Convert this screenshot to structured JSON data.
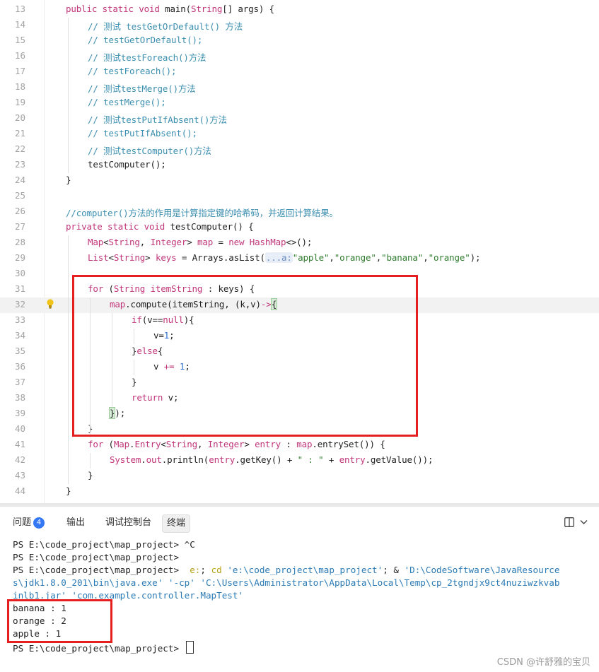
{
  "editor": {
    "current_line": 32,
    "lines": [
      {
        "n": "13",
        "tokens": [
          [
            "kw",
            "public static void "
          ],
          [
            "fn",
            "main("
          ],
          [
            "ty",
            "String"
          ],
          [
            "fn",
            "[] args) {"
          ]
        ],
        "indent": 0
      },
      {
        "n": "14",
        "tokens": [
          [
            "cm",
            "// 测试 testGetOrDefault() 方法"
          ]
        ],
        "indent": 1
      },
      {
        "n": "15",
        "tokens": [
          [
            "cm",
            "// testGetOrDefault();"
          ]
        ],
        "indent": 1
      },
      {
        "n": "16",
        "tokens": [
          [
            "cm",
            "// 测试testForeach()方法"
          ]
        ],
        "indent": 1
      },
      {
        "n": "17",
        "tokens": [
          [
            "cm",
            "// testForeach();"
          ]
        ],
        "indent": 1
      },
      {
        "n": "18",
        "tokens": [
          [
            "cm",
            "// 测试testMerge()方法"
          ]
        ],
        "indent": 1
      },
      {
        "n": "19",
        "tokens": [
          [
            "cm",
            "// testMerge();"
          ]
        ],
        "indent": 1
      },
      {
        "n": "20",
        "tokens": [
          [
            "cm",
            "// 测试testPutIfAbsent()方法"
          ]
        ],
        "indent": 1
      },
      {
        "n": "21",
        "tokens": [
          [
            "cm",
            "// testPutIfAbsent();"
          ]
        ],
        "indent": 1
      },
      {
        "n": "22",
        "tokens": [
          [
            "cm",
            "// 测试testComputer()方法"
          ]
        ],
        "indent": 1
      },
      {
        "n": "23",
        "tokens": [
          [
            "fn",
            "testComputer();"
          ]
        ],
        "indent": 1
      },
      {
        "n": "24",
        "tokens": [
          [
            "fn",
            "}"
          ]
        ],
        "indent": 0
      },
      {
        "n": "25",
        "tokens": [],
        "indent": 0
      },
      {
        "n": "26",
        "tokens": [
          [
            "cm",
            "//computer()方法的作用是计算指定键的哈希码，并返回计算结果。"
          ]
        ],
        "indent": 0
      },
      {
        "n": "27",
        "tokens": [
          [
            "kw",
            "private static void "
          ],
          [
            "fn",
            "testComputer() {"
          ]
        ],
        "indent": 0
      },
      {
        "n": "28",
        "tokens": [
          [
            "ty",
            "Map"
          ],
          [
            "fn",
            "<"
          ],
          [
            "ty",
            "String"
          ],
          [
            "fn",
            ", "
          ],
          [
            "ty",
            "Integer"
          ],
          [
            "fn",
            "> "
          ],
          [
            "fld",
            "map"
          ],
          [
            "fn",
            " = "
          ],
          [
            "kw",
            "new "
          ],
          [
            "ty",
            "HashMap"
          ],
          [
            "fn",
            "<>();"
          ]
        ],
        "indent": 1
      },
      {
        "n": "29",
        "tokens": [
          [
            "ty",
            "List"
          ],
          [
            "fn",
            "<"
          ],
          [
            "ty",
            "String"
          ],
          [
            "fn",
            "> "
          ],
          [
            "fld",
            "keys"
          ],
          [
            "fn",
            " = Arrays.asList("
          ],
          [
            "hint",
            "...a:"
          ],
          [
            "st",
            "\"apple\""
          ],
          [
            "fn",
            ","
          ],
          [
            "st",
            "\"orange\""
          ],
          [
            "fn",
            ","
          ],
          [
            "st",
            "\"banana\""
          ],
          [
            "fn",
            ","
          ],
          [
            "st",
            "\"orange\""
          ],
          [
            "fn",
            ");"
          ]
        ],
        "indent": 1
      },
      {
        "n": "30",
        "tokens": [],
        "indent": 0
      },
      {
        "n": "31",
        "tokens": [
          [
            "kw",
            "for "
          ],
          [
            "fn",
            "("
          ],
          [
            "ty",
            "String "
          ],
          [
            "fld",
            "itemString"
          ],
          [
            "fn",
            " : keys) {"
          ]
        ],
        "indent": 1
      },
      {
        "n": "32",
        "tokens": [
          [
            "fld",
            "map"
          ],
          [
            "fn",
            ".compute(itemString, (k,v)"
          ],
          [
            "kw",
            "->"
          ],
          [
            "bracematch",
            "{"
          ]
        ],
        "indent": 2
      },
      {
        "n": "33",
        "tokens": [
          [
            "kw",
            "if"
          ],
          [
            "fn",
            "(v=="
          ],
          [
            "kw",
            "null"
          ],
          [
            "fn",
            "){"
          ]
        ],
        "indent": 3
      },
      {
        "n": "34",
        "tokens": [
          [
            "fn",
            "v="
          ],
          [
            "nm",
            "1"
          ],
          [
            "fn",
            ";"
          ]
        ],
        "indent": 4
      },
      {
        "n": "35",
        "tokens": [
          [
            "fn",
            "}"
          ],
          [
            "kw",
            "else"
          ],
          [
            "fn",
            "{"
          ]
        ],
        "indent": 3
      },
      {
        "n": "36",
        "tokens": [
          [
            "fn",
            "v "
          ],
          [
            "kw",
            "+="
          ],
          [
            "fn",
            " "
          ],
          [
            "nm",
            "1"
          ],
          [
            "fn",
            ";"
          ]
        ],
        "indent": 4
      },
      {
        "n": "37",
        "tokens": [
          [
            "fn",
            "}"
          ]
        ],
        "indent": 3
      },
      {
        "n": "38",
        "tokens": [
          [
            "kw",
            "return "
          ],
          [
            "fn",
            "v;"
          ]
        ],
        "indent": 3
      },
      {
        "n": "39",
        "tokens": [
          [
            "bracematch",
            "}"
          ],
          [
            "fn",
            ");"
          ]
        ],
        "indent": 2
      },
      {
        "n": "40",
        "tokens": [
          [
            "fn",
            "}"
          ]
        ],
        "indent": 1
      },
      {
        "n": "41",
        "tokens": [
          [
            "kw",
            "for "
          ],
          [
            "fn",
            "("
          ],
          [
            "ty",
            "Map"
          ],
          [
            "fn",
            "."
          ],
          [
            "ty",
            "Entry"
          ],
          [
            "fn",
            "<"
          ],
          [
            "ty",
            "String"
          ],
          [
            "fn",
            ", "
          ],
          [
            "ty",
            "Integer"
          ],
          [
            "fn",
            "> "
          ],
          [
            "fld",
            "entry"
          ],
          [
            "fn",
            " : "
          ],
          [
            "fld",
            "map"
          ],
          [
            "fn",
            ".entrySet()) {"
          ]
        ],
        "indent": 1
      },
      {
        "n": "42",
        "tokens": [
          [
            "ty",
            "System"
          ],
          [
            "fn",
            "."
          ],
          [
            "fld",
            "out"
          ],
          [
            "fn",
            ".println("
          ],
          [
            "fld",
            "entry"
          ],
          [
            "fn",
            ".getKey() + "
          ],
          [
            "st",
            "\" : \""
          ],
          [
            "fn",
            " + "
          ],
          [
            "fld",
            "entry"
          ],
          [
            "fn",
            ".getValue());"
          ]
        ],
        "indent": 2
      },
      {
        "n": "43",
        "tokens": [
          [
            "fn",
            "}"
          ]
        ],
        "indent": 1
      },
      {
        "n": "44",
        "tokens": [
          [
            "fn",
            "}"
          ]
        ],
        "indent": 0
      }
    ]
  },
  "panel": {
    "tabs": [
      {
        "label": "问题",
        "badge": "4",
        "active": false
      },
      {
        "label": "输出",
        "active": false
      },
      {
        "label": "调试控制台",
        "active": false
      },
      {
        "label": "终端",
        "active": true
      }
    ],
    "layout_icon": "split-panel-icon",
    "chevron_icon": "chevron-down-icon"
  },
  "terminal": {
    "lines": [
      {
        "parts": [
          [
            "plain",
            "PS E:\\code_project\\map_project> ^C"
          ]
        ]
      },
      {
        "parts": [
          [
            "plain",
            "PS E:\\code_project\\map_project>"
          ]
        ]
      },
      {
        "parts": [
          [
            "plain",
            "PS E:\\code_project\\map_project>  "
          ],
          [
            "cmdkw",
            "e:"
          ],
          [
            "plain",
            "; "
          ],
          [
            "cmdkw",
            "cd"
          ],
          [
            "plain",
            " "
          ],
          [
            "tstr",
            "'e:\\code_project\\map_project'"
          ],
          [
            "plain",
            "; & "
          ],
          [
            "tstr",
            "'D:\\CodeSoftware\\JavaResource"
          ]
        ]
      },
      {
        "parts": [
          [
            "tstr",
            "s\\jdk1.8.0_201\\bin\\java.exe'"
          ],
          [
            "plain",
            " "
          ],
          [
            "tstr",
            "'-cp'"
          ],
          [
            "plain",
            " "
          ],
          [
            "tstr",
            "'C:\\Users\\Administrator\\AppData\\Local\\Temp\\cp_2tgndjx9ct4nuziwzkvab"
          ]
        ]
      },
      {
        "parts": [
          [
            "tstr",
            "inlb1.jar'"
          ],
          [
            "plain",
            " "
          ],
          [
            "tstr",
            "'com.example.controller.MapTest'"
          ]
        ]
      },
      {
        "parts": [
          [
            "plain",
            "banana : 1"
          ]
        ]
      },
      {
        "parts": [
          [
            "plain",
            "orange : 2"
          ]
        ]
      },
      {
        "parts": [
          [
            "plain",
            "apple : 1"
          ]
        ]
      },
      {
        "parts": [
          [
            "plain",
            "PS E:\\code_project\\map_project> "
          ]
        ],
        "cursor": true
      }
    ]
  },
  "watermark": "CSDN @许舒雅的宝贝",
  "colors": {
    "highlight_box": "#e51f1f",
    "badge": "#3478f6"
  }
}
